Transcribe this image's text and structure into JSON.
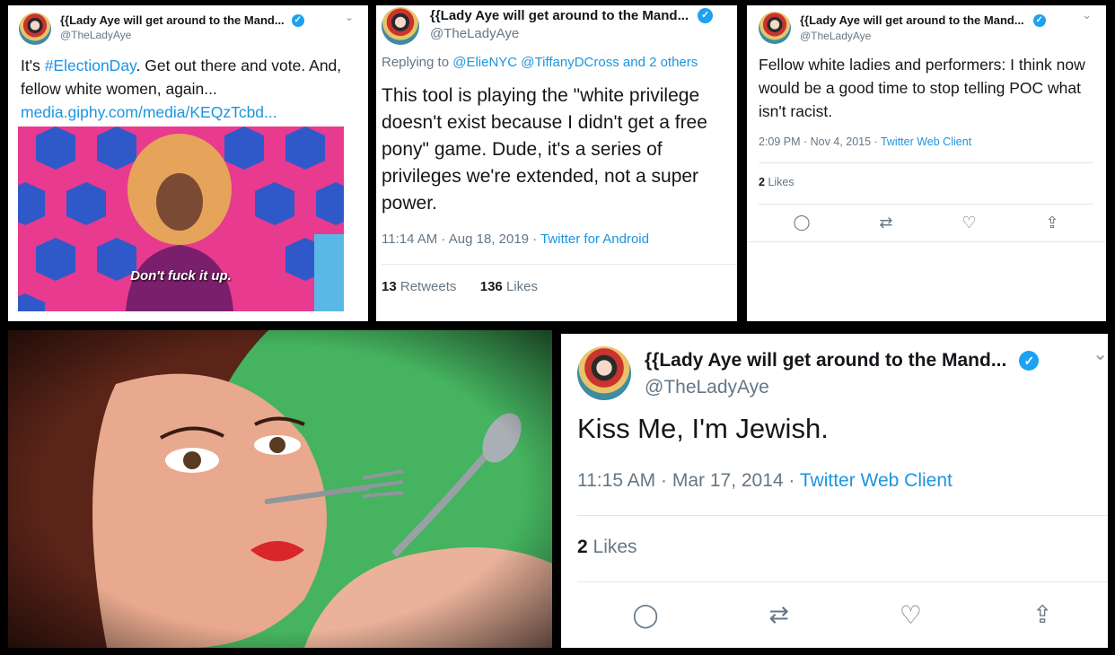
{
  "tweet1": {
    "display_name": "{{Lady Aye will get around to the Mand...",
    "handle": "@TheLadyAye",
    "text_prefix": "It's ",
    "hashtag": "#ElectionDay",
    "text_suffix": ". Get out there and vote. And, fellow white women, again...",
    "link": "media.giphy.com/media/KEQzTcbd...",
    "gif_caption": "Don't fuck it up."
  },
  "tweet2": {
    "display_name": "{{Lady Aye will get around to the Mand...",
    "handle": "@TheLadyAye",
    "replying_label": "Replying to",
    "reply_to": "@ElieNYC @TiffanyDCross and 2 others",
    "text": "This tool is playing the \"white privilege doesn't exist because I didn't get a free pony\" game. Dude, it's a series of privileges we're extended, not a super power.",
    "time": "11:14 AM · Aug 18, 2019 · ",
    "client": "Twitter for Android",
    "retweets": "13",
    "retweets_label": "Retweets",
    "likes": "136",
    "likes_label": "Likes"
  },
  "tweet3": {
    "display_name": "{{Lady Aye will get around to the Mand...",
    "handle": "@TheLadyAye",
    "text": "Fellow white ladies and performers: I think now would be a good time to stop telling POC what isn't racist.",
    "time": "2:09 PM · Nov 4, 2015 · ",
    "client": "Twitter Web Client",
    "likes": "2",
    "likes_label": "Likes"
  },
  "tweet5": {
    "display_name": "{{Lady Aye will get around to the Mand...",
    "handle": "@TheLadyAye",
    "text": "Kiss Me, I'm Jewish.",
    "time": "11:15 AM · Mar 17, 2014 · ",
    "client": "Twitter Web Client",
    "likes": "2",
    "likes_label": "Likes"
  },
  "icons": {
    "verified": "verified-badge-icon",
    "chevron": "chevron-down-icon",
    "reply": "reply-icon",
    "retweet": "retweet-icon",
    "like": "like-icon",
    "share": "share-icon"
  },
  "colors": {
    "link": "#1b95e0",
    "verified": "#1da1f2",
    "secondary_text": "#657786"
  }
}
